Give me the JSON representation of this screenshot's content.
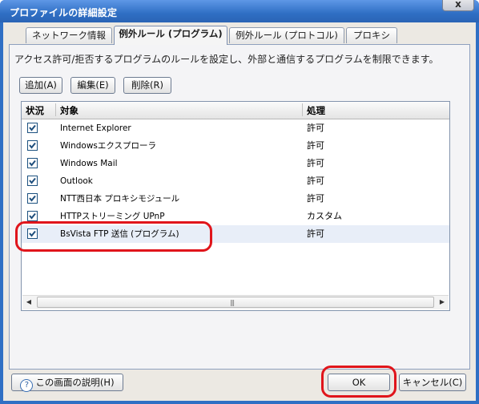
{
  "window": {
    "title": "プロファイルの詳細設定",
    "close_label": "x"
  },
  "tabs": [
    {
      "label": "ネットワーク情報",
      "active": false
    },
    {
      "label": "例外ルール (プログラム)",
      "active": true
    },
    {
      "label": "例外ルール (プロトコル)",
      "active": false
    },
    {
      "label": "プロキシ",
      "active": false
    }
  ],
  "description": "アクセス許可/拒否するプログラムのルールを設定し、外部と通信するプログラムを制限できます。",
  "toolbar": {
    "add_label": "追加(A)",
    "edit_label": "編集(E)",
    "delete_label": "削除(R)"
  },
  "list": {
    "columns": {
      "status": "状況",
      "target": "対象",
      "action": "処理"
    },
    "rows": [
      {
        "checked": true,
        "target": "Internet Explorer",
        "action": "許可"
      },
      {
        "checked": true,
        "target": "Windowsエクスプローラ",
        "action": "許可"
      },
      {
        "checked": true,
        "target": "Windows Mail",
        "action": "許可"
      },
      {
        "checked": true,
        "target": "Outlook",
        "action": "許可"
      },
      {
        "checked": true,
        "target": "NTT西日本 プロキシモジュール",
        "action": "許可"
      },
      {
        "checked": true,
        "target": "HTTPストリーミング UPnP",
        "action": "カスタム"
      },
      {
        "checked": true,
        "target": "BsVista FTP 送信 (プログラム)",
        "action": "許可",
        "selected": true
      }
    ],
    "scroll_left": "◀",
    "scroll_right": "▶",
    "scroll_grip": "|||"
  },
  "footer": {
    "help_icon_char": "?",
    "help_label": "この画面の説明(H)",
    "ok_label": "OK",
    "cancel_label": "キャンセル(C)"
  },
  "colors": {
    "annotation_red": "#e0151b",
    "title_blue": "#2f6fc4"
  }
}
